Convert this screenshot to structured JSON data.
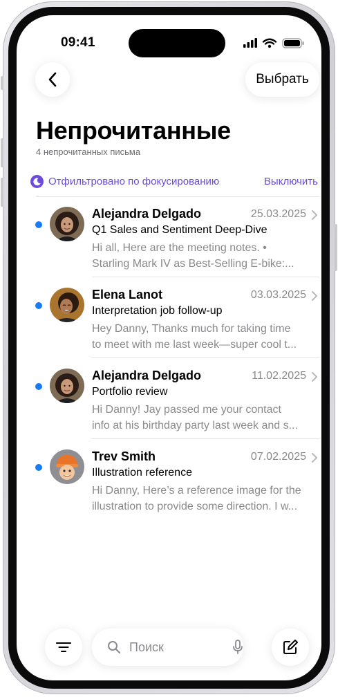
{
  "status": {
    "time": "09:41"
  },
  "nav": {
    "select_label": "Выбрать"
  },
  "header": {
    "title": "Непрочитанные",
    "subtitle": "4 непрочитанных письма"
  },
  "filter": {
    "text": "Отфильтровано по фокусированию",
    "off_label": "Выключить"
  },
  "messages": [
    {
      "sender": "Alejandra Delgado",
      "date": "25.03.2025",
      "subject": "Q1 Sales and Sentiment Deep-Dive",
      "preview_1": "Hi all, Here are the meeting notes. •",
      "preview_2": "Starling Mark IV as Best-Selling E-bike:...",
      "avatar": "woman-curly-hair-avatar"
    },
    {
      "sender": "Elena Lanot",
      "date": "03.03.2025",
      "subject": "Interpretation job follow-up",
      "preview_1": "Hey Danny, Thanks much for taking time",
      "preview_2": "to meet with me last week—super cool t...",
      "avatar": "woman-smiling-avatar"
    },
    {
      "sender": "Alejandra Delgado",
      "date": "11.02.2025",
      "subject": "Portfolio review",
      "preview_1": "Hi Danny! Jay passed me your contact",
      "preview_2": "info at his birthday party last week and s...",
      "avatar": "woman-curly-hair-avatar"
    },
    {
      "sender": "Trev Smith",
      "date": "07.02.2025",
      "subject": "Illustration reference",
      "preview_1": "Hi Danny, Here’s a reference image for the",
      "preview_2": "illustration to provide some direction. I w...",
      "avatar": "memoji-orange-hat-avatar"
    }
  ],
  "search": {
    "placeholder": "Поиск"
  },
  "colors": {
    "accent": "#6b4bd8",
    "unread": "#1a7cf5",
    "secondary_text": "#8a8a8e"
  }
}
